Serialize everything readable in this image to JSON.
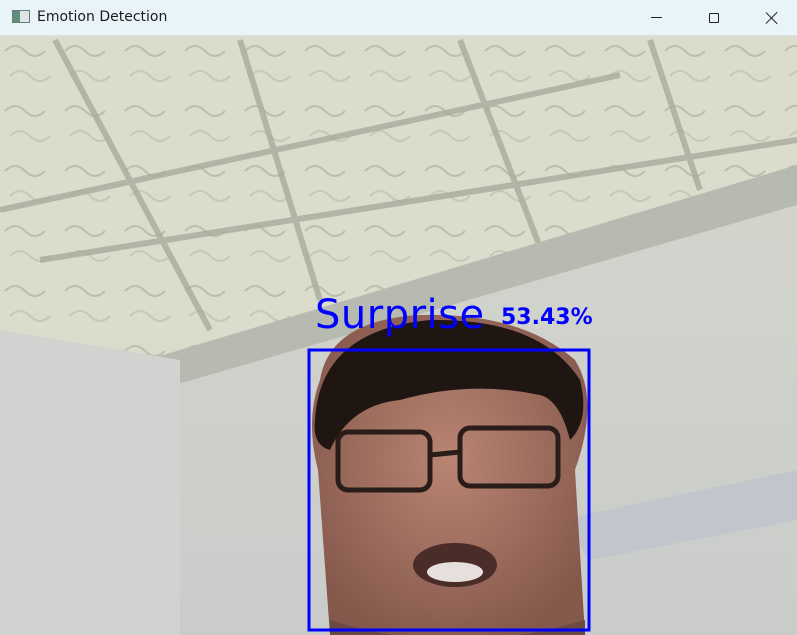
{
  "window": {
    "title": "Emotion Detection"
  },
  "controls": {
    "minimize": "minimize-icon",
    "maximize": "maximize-icon",
    "close": "close-icon"
  },
  "detection": {
    "emotion": "Surprise",
    "confidence": "53.43%",
    "box_color": "#0000ff"
  }
}
